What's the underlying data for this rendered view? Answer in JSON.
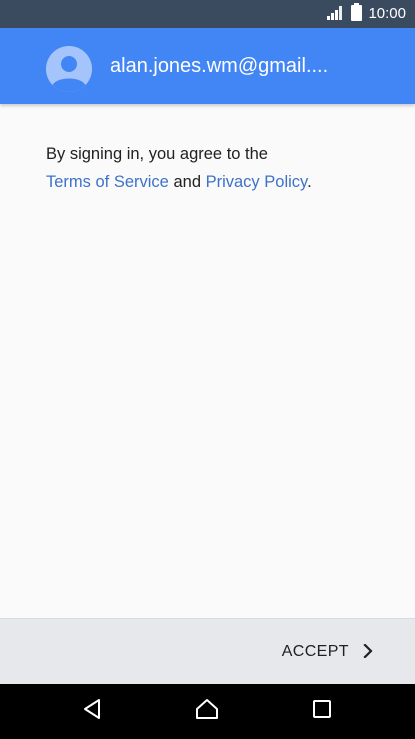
{
  "status_bar": {
    "time": "10:00",
    "signal_icon": "signal-icon",
    "battery_icon": "battery-icon"
  },
  "header": {
    "account_email": "alan.jones.wm@gmail....",
    "avatar_icon": "account-avatar-icon"
  },
  "content": {
    "text_before": "By signing in, you agree to the",
    "terms_link": "Terms of Service",
    "conjunction": "and",
    "privacy_link": "Privacy Policy",
    "period": "."
  },
  "action_bar": {
    "accept_label": "ACCEPT",
    "accept_icon": "chevron-right-icon"
  },
  "nav_bar": {
    "back_icon": "back-icon",
    "home_icon": "home-icon",
    "recents_icon": "recents-icon"
  },
  "colors": {
    "status_bar": "#3a4b60",
    "header": "#4285f4",
    "link": "#3e72c9",
    "action_bar": "#e6e8eb",
    "nav_bar": "#000000"
  }
}
